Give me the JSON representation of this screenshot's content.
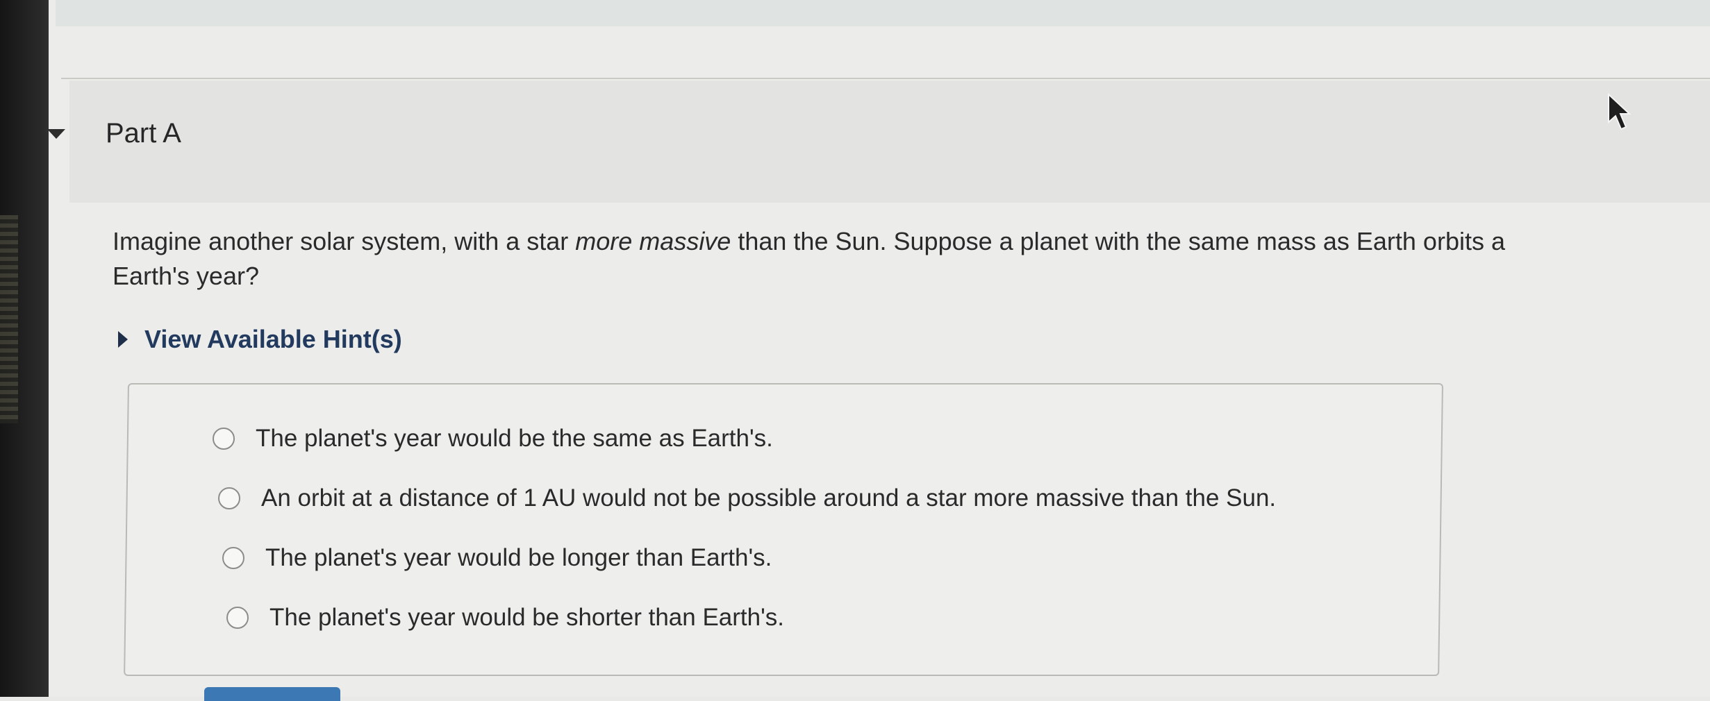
{
  "part": {
    "title": "Part A"
  },
  "question": {
    "line1_prefix": "Imagine another solar system, with a star ",
    "line1_emphasis": "more massive",
    "line1_suffix": " than the Sun. Suppose a planet with the same mass as Earth orbits a",
    "line2": "Earth's year?"
  },
  "hints": {
    "label": "View Available Hint(s)"
  },
  "options": [
    {
      "label": "The planet's year would be the same as Earth's."
    },
    {
      "label": "An orbit at a distance of 1 AU would not be possible around a star more massive than the Sun."
    },
    {
      "label": "The planet's year would be longer than Earth's."
    },
    {
      "label": "The planet's year would be shorter than Earth's."
    }
  ],
  "icons": {
    "part_toggle": "caret-down-icon",
    "hints_toggle": "caret-right-icon",
    "pointer": "mouse-cursor-icon"
  },
  "colors": {
    "hint_link": "#223a5e",
    "submit_button": "#3c78b4"
  }
}
